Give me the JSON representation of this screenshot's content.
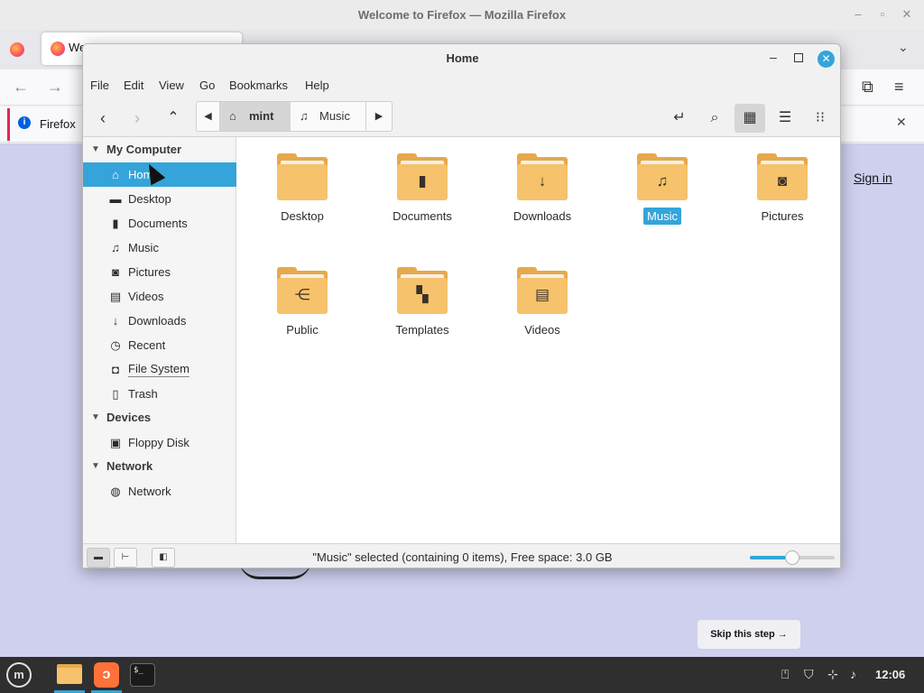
{
  "firefox": {
    "window_title": "Welcome to Firefox — Mozilla Firefox",
    "tab_label": "We",
    "infobar_text": "Firefox",
    "sign_in": "Sign in",
    "skip_step": "Skip this step →"
  },
  "nemo": {
    "window_title": "Home",
    "menu": [
      "File",
      "Edit",
      "View",
      "Go",
      "Bookmarks",
      "Help"
    ],
    "path": {
      "home": "mint",
      "current": "Music"
    },
    "sidebar": {
      "sections": [
        {
          "title": "My Computer",
          "items": [
            {
              "label": "Home",
              "icon": "home-icon",
              "selected": true
            },
            {
              "label": "Desktop",
              "icon": "desktop-icon"
            },
            {
              "label": "Documents",
              "icon": "document-icon"
            },
            {
              "label": "Music",
              "icon": "music-icon"
            },
            {
              "label": "Pictures",
              "icon": "camera-icon"
            },
            {
              "label": "Videos",
              "icon": "film-icon"
            },
            {
              "label": "Downloads",
              "icon": "download-icon"
            },
            {
              "label": "Recent",
              "icon": "clock-icon"
            },
            {
              "label": "File System",
              "icon": "drive-icon"
            },
            {
              "label": "Trash",
              "icon": "trash-icon"
            }
          ]
        },
        {
          "title": "Devices",
          "items": [
            {
              "label": "Floppy Disk",
              "icon": "floppy-icon"
            }
          ]
        },
        {
          "title": "Network",
          "items": [
            {
              "label": "Network",
              "icon": "globe-icon"
            }
          ]
        }
      ]
    },
    "files": [
      {
        "label": "Desktop",
        "emblem": "none"
      },
      {
        "label": "Documents",
        "emblem": "document-icon"
      },
      {
        "label": "Downloads",
        "emblem": "download-icon"
      },
      {
        "label": "Music",
        "emblem": "music-icon",
        "selected": true
      },
      {
        "label": "Pictures",
        "emblem": "camera-icon"
      },
      {
        "label": "Public",
        "emblem": "share-icon"
      },
      {
        "label": "Templates",
        "emblem": "template-icon"
      },
      {
        "label": "Videos",
        "emblem": "film-icon"
      }
    ],
    "status": "\"Music\" selected (containing 0 items), Free space: 3.0 GB",
    "zoom_level": 0.5
  },
  "taskbar": {
    "clock": "12:06",
    "apps": [
      "files",
      "firefox",
      "terminal"
    ],
    "terminal_glyph": "$_"
  },
  "colors": {
    "accent": "#35a4da",
    "folder": "#f6c26b",
    "folder_dark": "#e6a94c"
  }
}
